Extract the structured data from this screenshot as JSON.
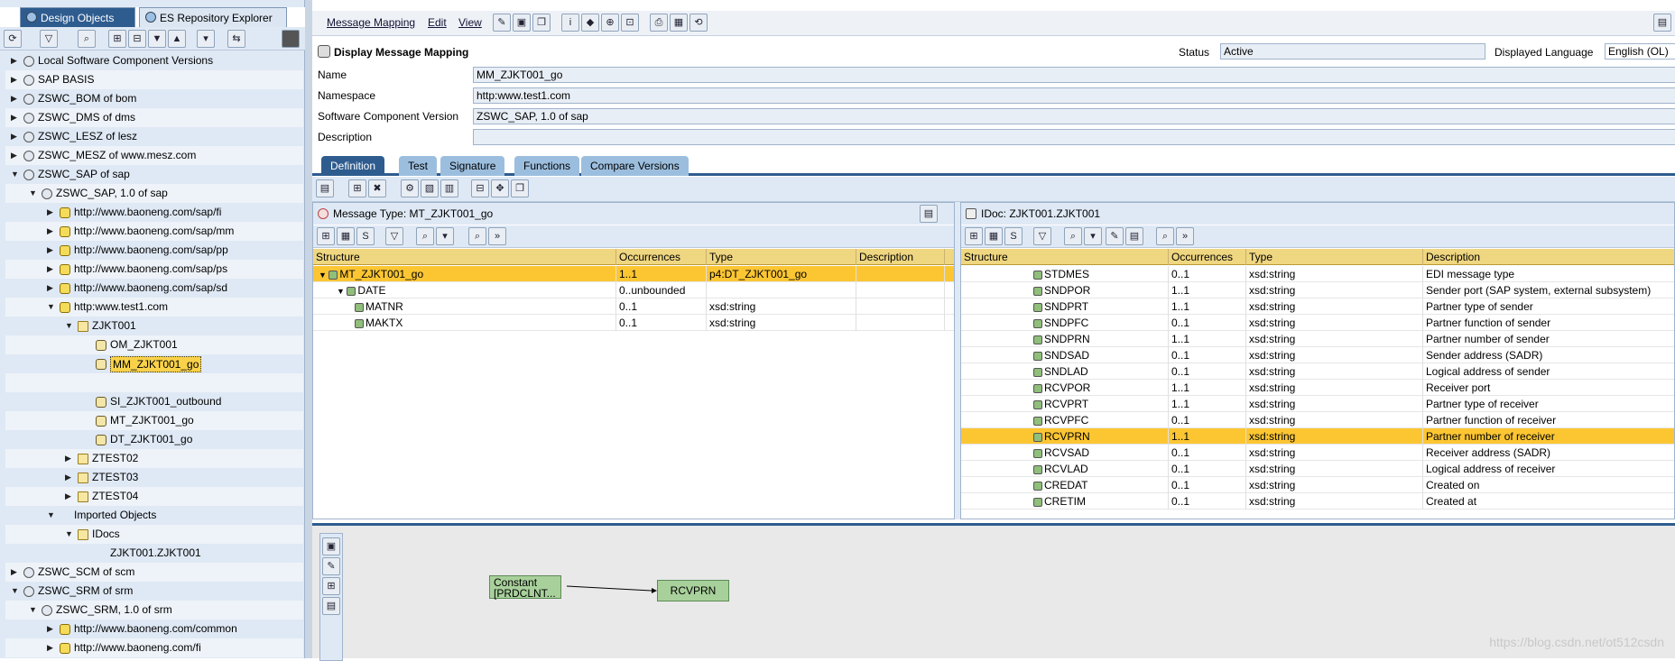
{
  "left_tabs": {
    "design": "Design Objects",
    "repo": "ES Repository Explorer"
  },
  "tree": [
    {
      "label": "Local Software Component Versions",
      "lvl": 0,
      "arrow": "▶",
      "icon": "sw"
    },
    {
      "label": "SAP BASIS",
      "lvl": 0,
      "arrow": "▶",
      "icon": "sw"
    },
    {
      "label": "ZSWC_BOM of bom",
      "lvl": 0,
      "arrow": "▶",
      "icon": "sw"
    },
    {
      "label": "ZSWC_DMS of dms",
      "lvl": 0,
      "arrow": "▶",
      "icon": "sw"
    },
    {
      "label": "ZSWC_LESZ of lesz",
      "lvl": 0,
      "arrow": "▶",
      "icon": "sw"
    },
    {
      "label": "ZSWC_MESZ of www.mesz.com",
      "lvl": 0,
      "arrow": "▶",
      "icon": "sw"
    },
    {
      "label": "ZSWC_SAP of sap",
      "lvl": 0,
      "arrow": "▼",
      "icon": "sw"
    },
    {
      "label": "ZSWC_SAP, 1.0 of sap",
      "lvl": 1,
      "arrow": "▼",
      "icon": "sw"
    },
    {
      "label": "http://www.baoneng.com/sap/fi",
      "lvl": 2,
      "arrow": "▶",
      "icon": "ns"
    },
    {
      "label": "http://www.baoneng.com/sap/mm",
      "lvl": 2,
      "arrow": "▶",
      "icon": "ns"
    },
    {
      "label": "http://www.baoneng.com/sap/pp",
      "lvl": 2,
      "arrow": "▶",
      "icon": "ns"
    },
    {
      "label": "http://www.baoneng.com/sap/ps",
      "lvl": 2,
      "arrow": "▶",
      "icon": "ns"
    },
    {
      "label": "http://www.baoneng.com/sap/sd",
      "lvl": 2,
      "arrow": "▶",
      "icon": "ns"
    },
    {
      "label": "http:www.test1.com",
      "lvl": 2,
      "arrow": "▼",
      "icon": "ns"
    },
    {
      "label": "ZJKT001",
      "lvl": 3,
      "arrow": "▼",
      "icon": "fold"
    },
    {
      "label": "OM_ZJKT001",
      "lvl": 4,
      "arrow": "",
      "icon": "obj"
    },
    {
      "label": "MM_ZJKT001_go",
      "lvl": 4,
      "arrow": "",
      "icon": "obj",
      "selected": true
    },
    {
      "label": "",
      "lvl": 4,
      "arrow": "",
      "icon": "none"
    },
    {
      "label": "SI_ZJKT001_outbound",
      "lvl": 4,
      "arrow": "",
      "icon": "obj"
    },
    {
      "label": "MT_ZJKT001_go",
      "lvl": 4,
      "arrow": "",
      "icon": "obj"
    },
    {
      "label": "DT_ZJKT001_go",
      "lvl": 4,
      "arrow": "",
      "icon": "obj"
    },
    {
      "label": "ZTEST02",
      "lvl": 3,
      "arrow": "▶",
      "icon": "fold"
    },
    {
      "label": "ZTEST03",
      "lvl": 3,
      "arrow": "▶",
      "icon": "fold"
    },
    {
      "label": "ZTEST04",
      "lvl": 3,
      "arrow": "▶",
      "icon": "fold"
    },
    {
      "label": "Imported Objects",
      "lvl": 2,
      "arrow": "▼",
      "icon": "none"
    },
    {
      "label": "IDocs",
      "lvl": 3,
      "arrow": "▼",
      "icon": "fold"
    },
    {
      "label": "ZJKT001.ZJKT001",
      "lvl": 4,
      "arrow": "",
      "icon": "none"
    },
    {
      "label": "ZSWC_SCM of scm",
      "lvl": 0,
      "arrow": "▶",
      "icon": "sw"
    },
    {
      "label": "ZSWC_SRM of srm",
      "lvl": 0,
      "arrow": "▼",
      "icon": "sw"
    },
    {
      "label": "ZSWC_SRM, 1.0 of srm",
      "lvl": 1,
      "arrow": "▼",
      "icon": "sw"
    },
    {
      "label": "http://www.baoneng.com/common",
      "lvl": 2,
      "arrow": "▶",
      "icon": "ns"
    },
    {
      "label": "http://www.baoneng.com/fi",
      "lvl": 2,
      "arrow": "▶",
      "icon": "ns"
    },
    {
      "label": "http://www.baoneng.com/mm",
      "lvl": 2,
      "arrow": "▶",
      "icon": "ns"
    }
  ],
  "menu": {
    "message_mapping": "Message Mapping",
    "edit": "Edit",
    "view": "View"
  },
  "header": {
    "title": "Display Message Mapping",
    "status_label": "Status",
    "status_value": "Active",
    "lang_label": "Displayed Language",
    "lang_value": "English (OL)"
  },
  "fields": {
    "name_label": "Name",
    "name_value": "MM_ZJKT001_go",
    "ns_label": "Namespace",
    "ns_value": "http:www.test1.com",
    "swcv_label": "Software Component Version",
    "swcv_value": "ZSWC_SAP, 1.0 of sap",
    "desc_label": "Description",
    "desc_value": ""
  },
  "tabs": [
    "Definition",
    "Test",
    "Signature",
    "Functions",
    "Compare Versions"
  ],
  "source": {
    "title": "Message Type: MT_ZJKT001_go",
    "headers": [
      "Structure",
      "Occurrences",
      "Type",
      "Description"
    ],
    "rows": [
      {
        "s": "MT_ZJKT001_go",
        "o": "1..1",
        "t": "p4:DT_ZJKT001_go",
        "d": "",
        "ind": 0,
        "exp": "▼",
        "hl": true
      },
      {
        "s": "DATE",
        "o": "0..unbounded",
        "t": "",
        "d": "",
        "ind": 1,
        "exp": "▼",
        "hl": false
      },
      {
        "s": "MATNR",
        "o": "0..1",
        "t": "xsd:string",
        "d": "",
        "ind": 2,
        "exp": "",
        "hl": false
      },
      {
        "s": "MAKTX",
        "o": "0..1",
        "t": "xsd:string",
        "d": "",
        "ind": 2,
        "exp": "",
        "hl": false
      }
    ]
  },
  "target": {
    "title": "IDoc: ZJKT001.ZJKT001",
    "headers": [
      "Structure",
      "Occurrences",
      "Type",
      "Description"
    ],
    "rows": [
      {
        "s": "STDMES",
        "o": "0..1",
        "t": "xsd:string",
        "d": "EDI message type",
        "hl": false
      },
      {
        "s": "SNDPOR",
        "o": "1..1",
        "t": "xsd:string",
        "d": "Sender port (SAP system, external subsystem)",
        "hl": false
      },
      {
        "s": "SNDPRT",
        "o": "1..1",
        "t": "xsd:string",
        "d": "Partner type of sender",
        "hl": false
      },
      {
        "s": "SNDPFC",
        "o": "0..1",
        "t": "xsd:string",
        "d": "Partner function of sender",
        "hl": false
      },
      {
        "s": "SNDPRN",
        "o": "1..1",
        "t": "xsd:string",
        "d": "Partner number of sender",
        "hl": false
      },
      {
        "s": "SNDSAD",
        "o": "0..1",
        "t": "xsd:string",
        "d": "Sender address (SADR)",
        "hl": false
      },
      {
        "s": "SNDLAD",
        "o": "0..1",
        "t": "xsd:string",
        "d": "Logical address of sender",
        "hl": false
      },
      {
        "s": "RCVPOR",
        "o": "1..1",
        "t": "xsd:string",
        "d": "Receiver port",
        "hl": false
      },
      {
        "s": "RCVPRT",
        "o": "1..1",
        "t": "xsd:string",
        "d": "Partner type of receiver",
        "hl": false
      },
      {
        "s": "RCVPFC",
        "o": "0..1",
        "t": "xsd:string",
        "d": "Partner function of receiver",
        "hl": false
      },
      {
        "s": "RCVPRN",
        "o": "1..1",
        "t": "xsd:string",
        "d": "Partner number of receiver",
        "hl": true
      },
      {
        "s": "RCVSAD",
        "o": "0..1",
        "t": "xsd:string",
        "d": "Receiver address (SADR)",
        "hl": false
      },
      {
        "s": "RCVLAD",
        "o": "0..1",
        "t": "xsd:string",
        "d": "Logical address of receiver",
        "hl": false
      },
      {
        "s": "CREDAT",
        "o": "0..1",
        "t": "xsd:string",
        "d": "Created on",
        "hl": false
      },
      {
        "s": "CRETIM",
        "o": "0..1",
        "t": "xsd:string",
        "d": "Created at",
        "hl": false
      }
    ]
  },
  "graph": {
    "constant_l1": "Constant",
    "constant_l2": "[PRDCLNT...",
    "target_node": "RCVPRN"
  },
  "watermark": "https://blog.csdn.net/ot512csdn"
}
